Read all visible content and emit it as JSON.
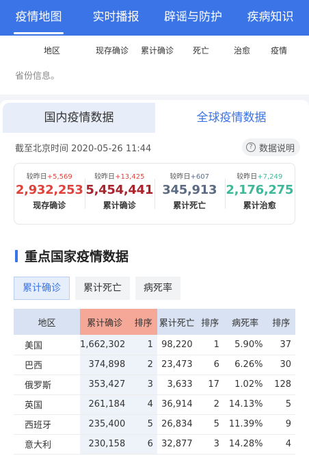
{
  "nav": {
    "tabs": [
      {
        "label": "疫情地图",
        "active": true
      },
      {
        "label": "实时播报",
        "active": false
      },
      {
        "label": "辟谣与防护",
        "active": false
      },
      {
        "label": "疾病知识",
        "active": false
      }
    ]
  },
  "top_table": {
    "headers": [
      "地区",
      "现存确诊",
      "累计确诊",
      "死亡",
      "治愈",
      "疫情"
    ],
    "note": "省份信息。"
  },
  "segment": {
    "domestic": "国内疫情数据",
    "global": "全球疫情数据"
  },
  "as_of": "截至北京时间 2020-05-26 11:44",
  "explain": {
    "icon": "question-circle-icon",
    "label": "数据说明"
  },
  "stats": [
    {
      "cmp_label": "较昨日",
      "delta": "+5,569",
      "value": "2,932,253",
      "label": "现存确诊",
      "color": "#e0413a"
    },
    {
      "cmp_label": "较昨日",
      "delta": "+13,425",
      "value": "5,454,441",
      "label": "累计确诊",
      "color": "#a8232c"
    },
    {
      "cmp_label": "较昨日",
      "delta": "+607",
      "value": "345,913",
      "label": "累计死亡",
      "color": "#5c6a82"
    },
    {
      "cmp_label": "较昨日",
      "delta": "+7,249",
      "value": "2,176,275",
      "label": "累计治愈",
      "color": "#3fb89a"
    }
  ],
  "section": {
    "title": "重点国家疫情数据"
  },
  "filters": [
    {
      "label": "累计确诊",
      "active": true
    },
    {
      "label": "累计死亡",
      "active": false
    },
    {
      "label": "病死率",
      "active": false
    }
  ],
  "table": {
    "headers": [
      "地区",
      "累计确诊",
      "排序",
      "累计死亡",
      "排序",
      "病死率",
      "排序"
    ],
    "rows": [
      [
        "美国",
        "1,662,302",
        "1",
        "98,220",
        "1",
        "5.90%",
        "37"
      ],
      [
        "巴西",
        "374,898",
        "2",
        "23,473",
        "6",
        "6.26%",
        "30"
      ],
      [
        "俄罗斯",
        "353,427",
        "3",
        "3,633",
        "17",
        "1.02%",
        "128"
      ],
      [
        "英国",
        "261,184",
        "4",
        "36,914",
        "2",
        "14.13%",
        "5"
      ],
      [
        "西班牙",
        "235,400",
        "5",
        "26,834",
        "5",
        "11.39%",
        "9"
      ],
      [
        "意大利",
        "230,158",
        "6",
        "32,877",
        "3",
        "14.28%",
        "4"
      ]
    ]
  },
  "colors": {
    "accent": "#3a74e6",
    "existing": "#e0413a",
    "confirmed": "#a8232c",
    "deaths": "#5c6a82",
    "cured": "#3fb89a",
    "delta_red": "#e0413a",
    "delta_gray": "#5c6a82",
    "delta_green": "#3fb89a"
  }
}
